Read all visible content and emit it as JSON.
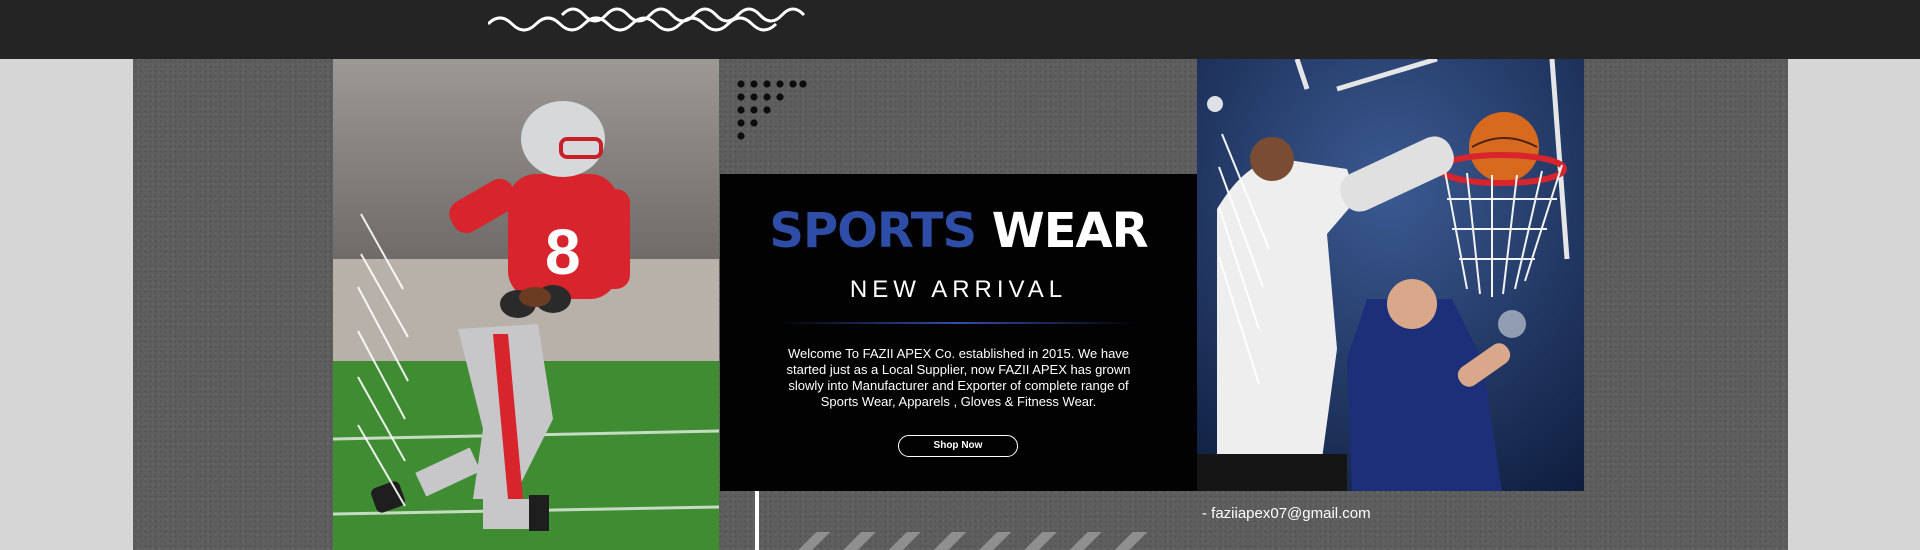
{
  "banner": {
    "headline_part1": "SPORTS",
    "headline_part2": "WEAR",
    "subheading": "NEW ARRIVAL",
    "description": "Welcome To FAZII APEX Co. established in 2015. We have started just as a Local Supplier, now FAZII APEX has grown slowly into Manufacturer and Exporter of complete range of Sports Wear, Apparels , Gloves & Fitness Wear.",
    "shop_button_label": "Shop Now"
  },
  "contact": {
    "email": "- faziiapex07@gmail.com"
  },
  "colors": {
    "accent_blue": "#2e4da6",
    "promo_background": "#020202",
    "topbar": "#242424",
    "panel": "#5e5e5e"
  },
  "images": {
    "left_photo": "american-football-player-running-with-ball",
    "right_photo": "basketball-players-dunking-at-hoop"
  }
}
